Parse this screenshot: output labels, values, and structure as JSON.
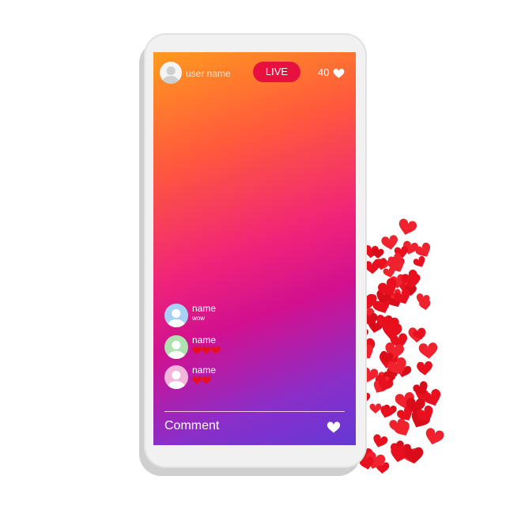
{
  "header": {
    "username": "user name",
    "live_label": "LIVE",
    "like_count": "40"
  },
  "comments": [
    {
      "name": "name",
      "text": "wow",
      "avatar_color": "#a8d2f5",
      "hearts": 0
    },
    {
      "name": "name",
      "text": "",
      "avatar_color": "#aee0b0",
      "hearts": 3
    },
    {
      "name": "name",
      "text": "",
      "avatar_color": "#f2b6da",
      "hearts": 2
    }
  ],
  "footer": {
    "comment_label": "Comment"
  },
  "colors": {
    "live_badge": "#e8103f",
    "heart_red": "#e8101e",
    "gradient_top": "#ff9a1e",
    "gradient_mid": "#d1108f",
    "gradient_bottom": "#6438d6"
  },
  "icons": [
    "heart-icon",
    "user-avatar-icon"
  ]
}
